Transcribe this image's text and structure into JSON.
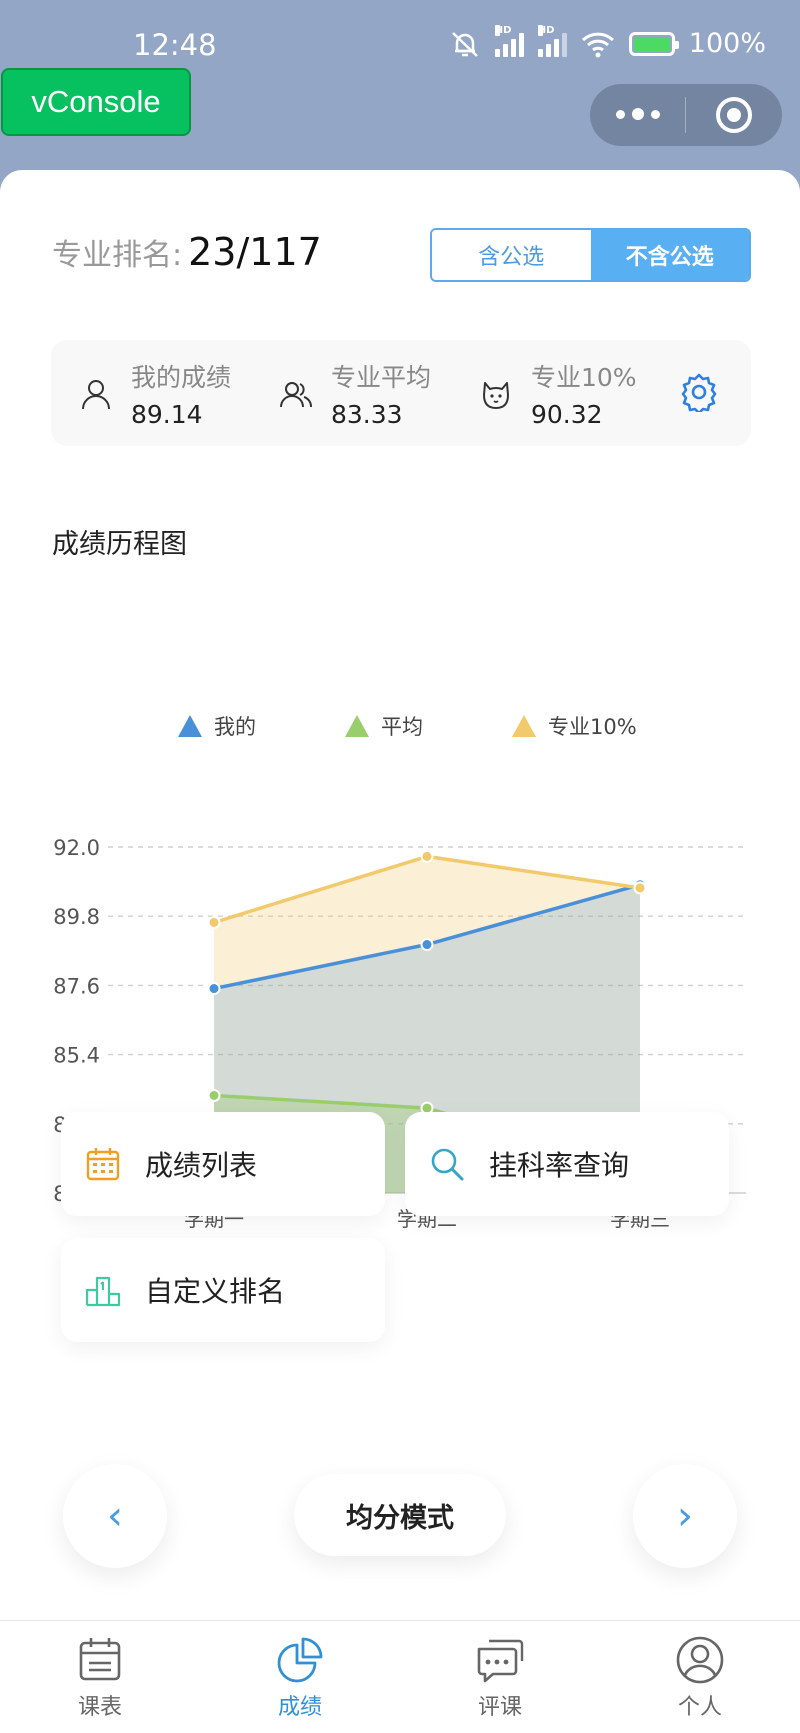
{
  "status": {
    "time": "12:48",
    "battery": "100%",
    "hd1": "HD",
    "hd2": "HD"
  },
  "vconsole": {
    "label": "vConsole"
  },
  "rank": {
    "label": "专业排名:",
    "value": "23/117"
  },
  "toggle": {
    "option1": "含公选",
    "option2": "不含公选",
    "selected": "不含公选"
  },
  "stats": [
    {
      "icon": "user-icon",
      "label": "我的成绩",
      "value": "89.14"
    },
    {
      "icon": "users-icon",
      "label": "专业平均",
      "value": "83.33"
    },
    {
      "icon": "cat-icon",
      "label": "专业10%",
      "value": "90.32"
    }
  ],
  "chart_section": {
    "title": "成绩历程图"
  },
  "chart_data": {
    "type": "line",
    "categories": [
      "学期一",
      "学期二",
      "学期三"
    ],
    "series": [
      {
        "name": "我的",
        "values": [
          87.5,
          88.9,
          90.8
        ],
        "color": "#4a90d9"
      },
      {
        "name": "平均",
        "values": [
          84.1,
          83.7,
          81.7
        ],
        "color": "#9acd6c"
      },
      {
        "name": "专业10%",
        "values": [
          89.6,
          91.7,
          90.7
        ],
        "color": "#f2c96b"
      }
    ],
    "ylim": [
      81.0,
      92.0
    ],
    "yticks": [
      "81.0",
      "83.2",
      "85.4",
      "87.6",
      "89.8",
      "92.0"
    ],
    "grid": true,
    "legend": "top"
  },
  "menu": [
    {
      "icon": "calendar-icon",
      "label": "成绩列表"
    },
    {
      "icon": "search-icon",
      "label": "挂科率查询"
    },
    {
      "icon": "podium-icon",
      "label": "自定义排名"
    }
  ],
  "pager": {
    "mode": "均分模式",
    "prev": "‹",
    "next": "›"
  },
  "tabs": [
    {
      "label": "课表",
      "active": false
    },
    {
      "label": "成绩",
      "active": true
    },
    {
      "label": "评课",
      "active": false
    },
    {
      "label": "个人",
      "active": false
    }
  ],
  "colors": {
    "accent": "#4a9be6",
    "tab_active": "#2f90d6",
    "vconsole": "#07c160"
  }
}
